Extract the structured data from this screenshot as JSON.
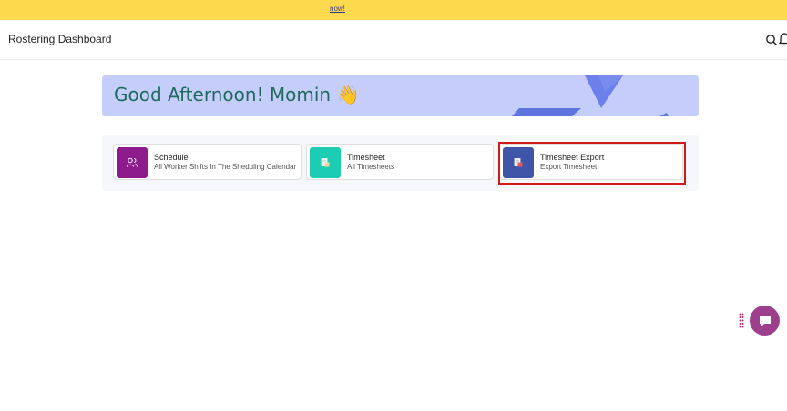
{
  "banner": {
    "link_text": "now!"
  },
  "topbar": {
    "title": "Rostering Dashboard"
  },
  "hero": {
    "greeting": "Good Afternoon! Momin 👋"
  },
  "cards": [
    {
      "title": "Schedule",
      "subtitle": "All Worker Shifts In The Sheduling Calendar",
      "icon": "users-icon",
      "color": "#8e1b8c"
    },
    {
      "title": "Timesheet",
      "subtitle": "All Timesheets",
      "icon": "timesheet-icon",
      "color": "#1ccdb3"
    },
    {
      "title": "Timesheet Export",
      "subtitle": "Export Timesheet",
      "icon": "export-icon",
      "color": "#3e55a8"
    }
  ],
  "colors": {
    "banner": "#fdd94e",
    "hero_bg": "#c5cdfa",
    "hero_text": "#1f6b5b",
    "highlight": "#d01a1a",
    "chat": "#9e3f8e"
  }
}
